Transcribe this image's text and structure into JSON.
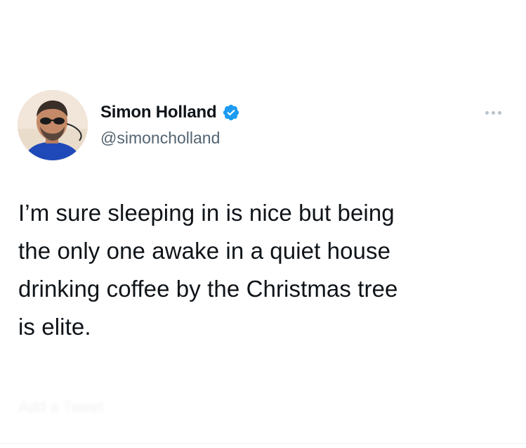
{
  "author": {
    "display_name": "Simon Holland",
    "handle": "@simoncholland",
    "verified": true
  },
  "tweet": {
    "text": "I’m sure sleeping in is nice but being\nthe only one awake in a quiet house\ndrinking coffee by the Christmas tree\nis elite."
  },
  "faded_action": {
    "label": "Add a Tweet"
  },
  "colors": {
    "text_primary": "#0f1419",
    "text_secondary": "#536471",
    "verified_blue": "#1d9bf0",
    "menu_dots": "#b9c1c8"
  },
  "icons": {
    "verified": "verified-badge-icon",
    "more": "more-dots-icon"
  }
}
